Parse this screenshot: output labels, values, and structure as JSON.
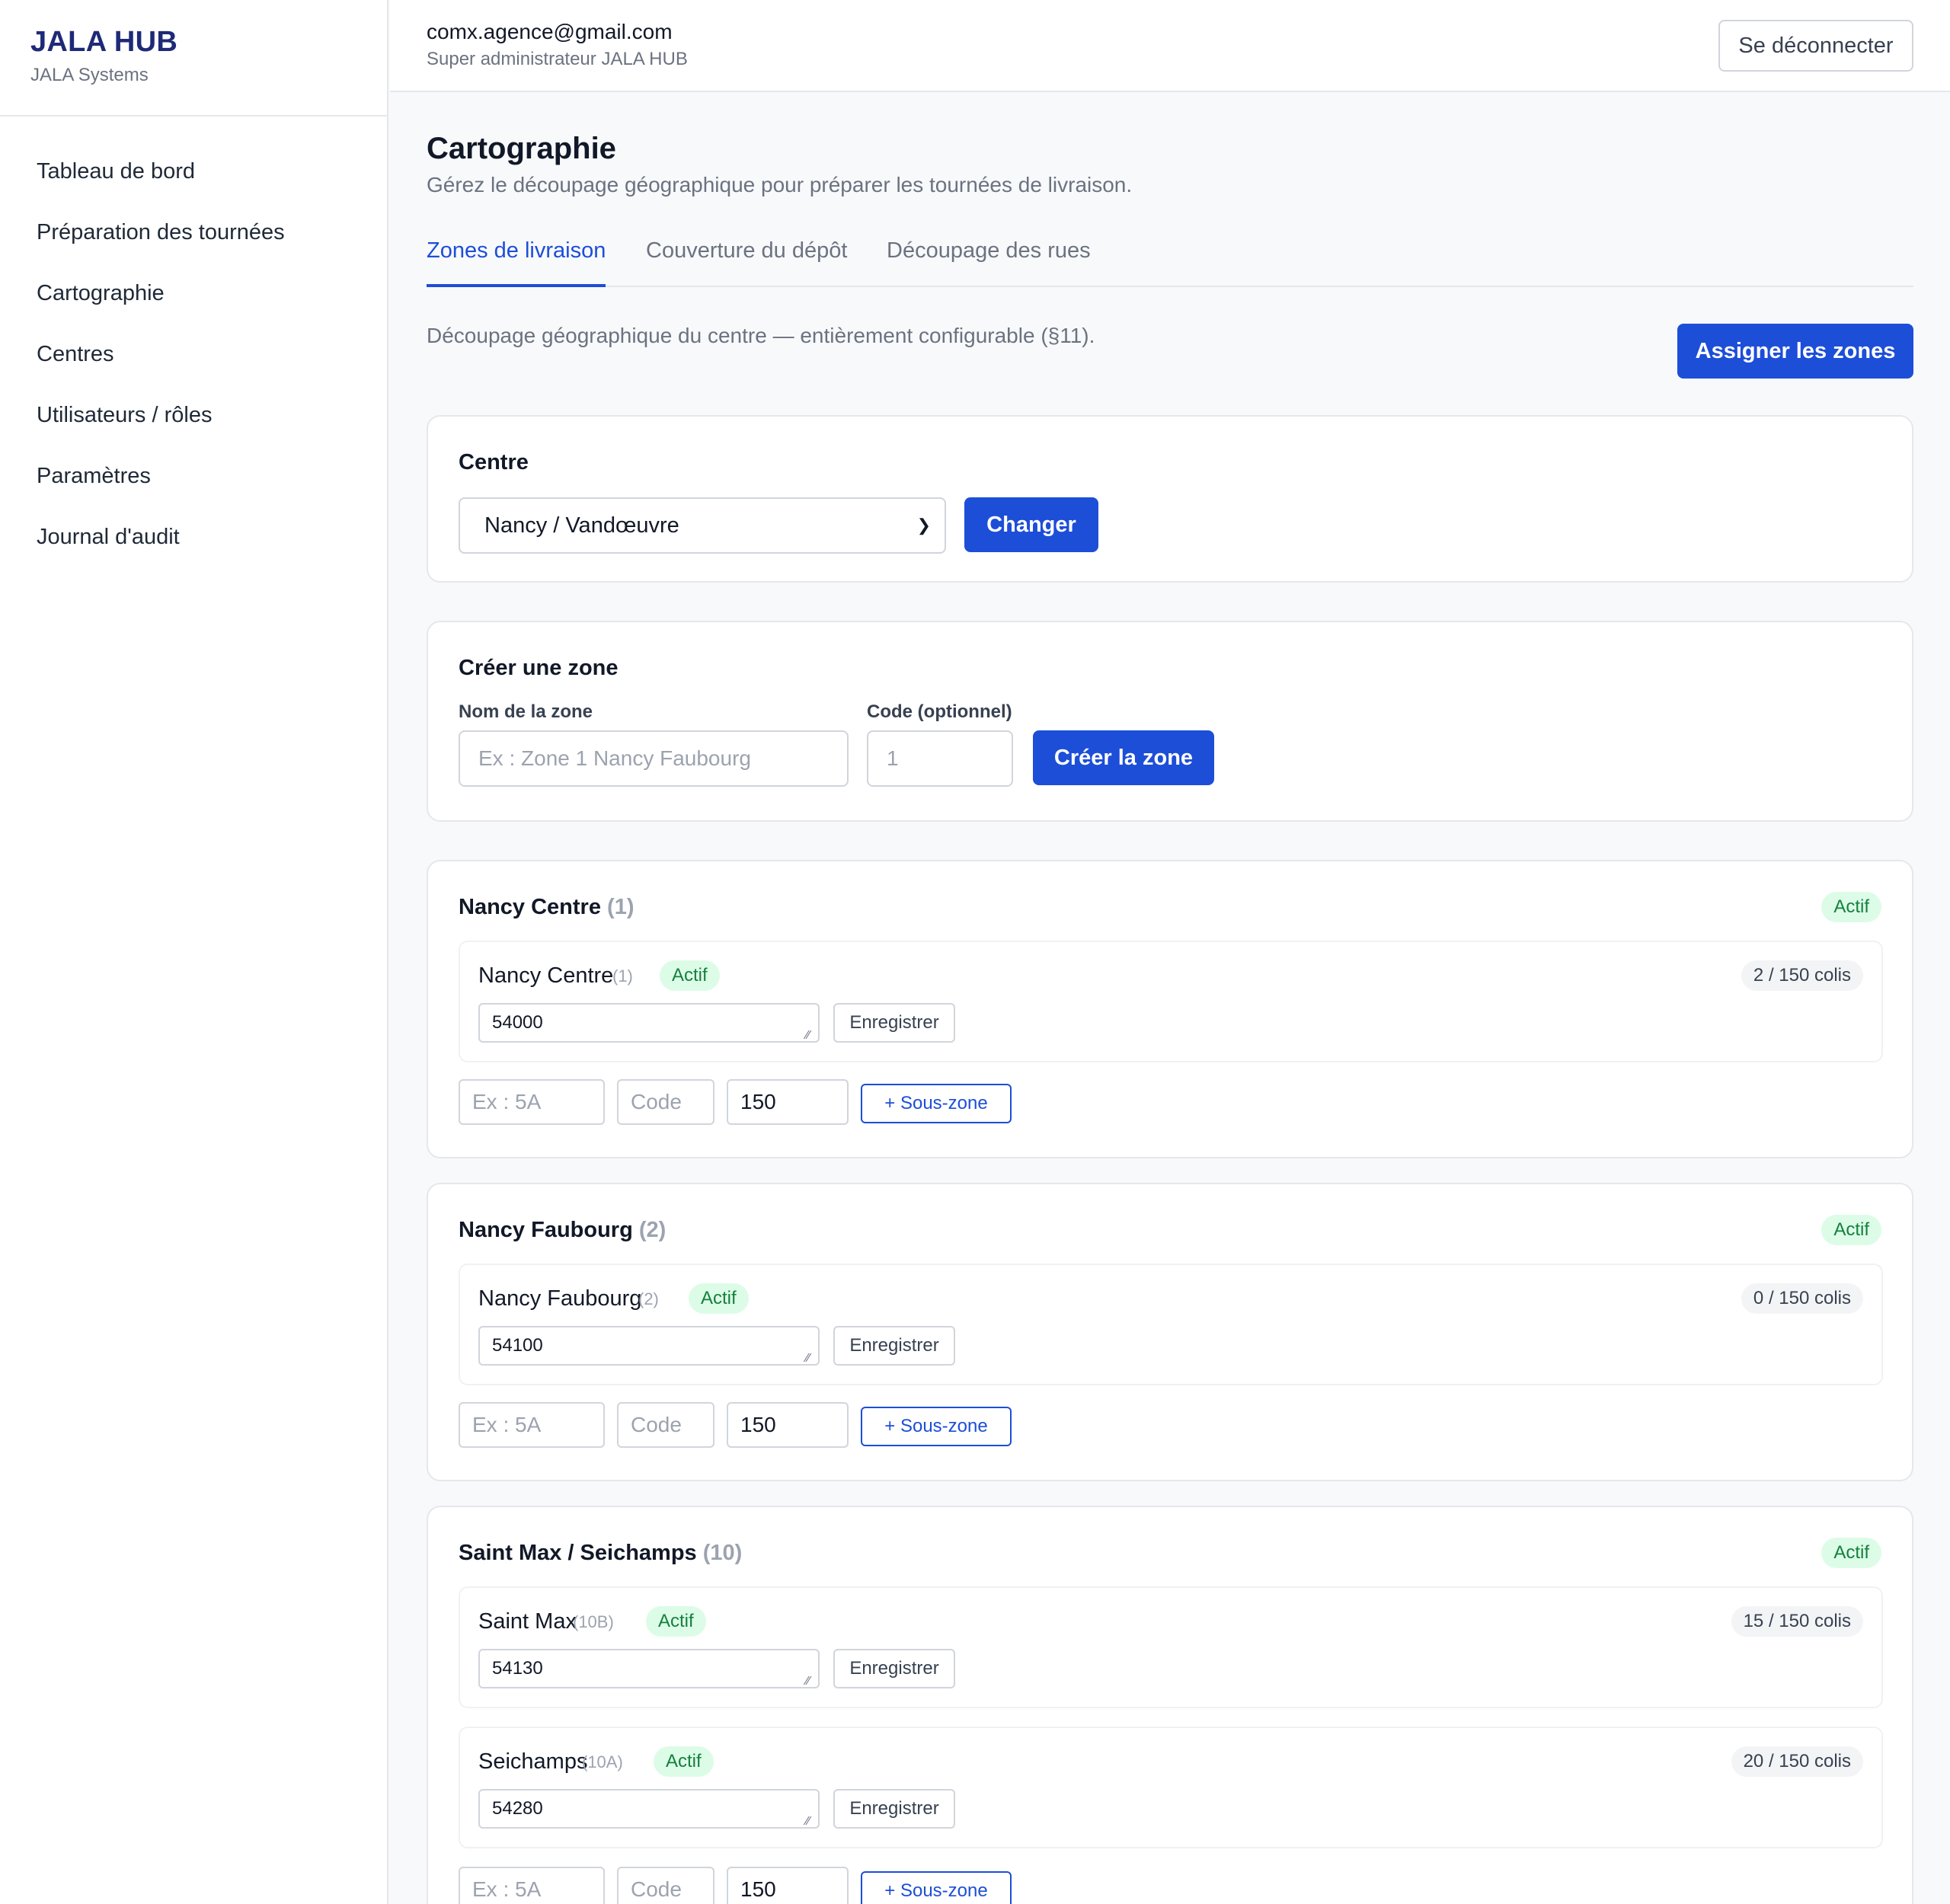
{
  "brand": {
    "title": "JALA HUB",
    "subtitle": "JALA Systems"
  },
  "nav": [
    "Tableau de bord",
    "Préparation des tournées",
    "Cartographie",
    "Centres",
    "Utilisateurs / rôles",
    "Paramètres",
    "Journal d'audit"
  ],
  "topbar": {
    "email": "comx.agence@gmail.com",
    "role": "Super administrateur JALA HUB",
    "logout": "Se déconnecter"
  },
  "page": {
    "title": "Cartographie",
    "subtitle": "Gérez le découpage géographique pour préparer les tournées de livraison."
  },
  "tabs": [
    "Zones de livraison",
    "Couverture du dépôt",
    "Découpage des rues"
  ],
  "active_tab": "Zones de livraison",
  "description": "Découpage géographique du centre — entièrement configurable (§11).",
  "assign_button": "Assigner les zones",
  "centre_card": {
    "title": "Centre",
    "selected": "Nancy / Vandœuvre",
    "change_button": "Changer"
  },
  "create_card": {
    "title": "Créer une zone",
    "name_label": "Nom de la zone",
    "name_placeholder": "Ex : Zone 1 Nancy Faubourg",
    "code_label": "Code (optionnel)",
    "code_placeholder": "1",
    "create_button": "Créer la zone"
  },
  "common": {
    "status": "Actif",
    "save": "Enregistrer",
    "subzone_name_placeholder": "Ex : 5A",
    "subzone_code_placeholder": "Code",
    "subzone_capacity": "150",
    "add_subzone": "+ Sous-zone"
  },
  "zones": [
    {
      "name": "Nancy Centre",
      "code": "(1)",
      "status": "Actif",
      "subzones": [
        {
          "name": "Nancy Centre",
          "code": "(1)",
          "status": "Actif",
          "postcodes": "54000",
          "count": "2 / 150 colis"
        }
      ]
    },
    {
      "name": "Nancy Faubourg",
      "code": "(2)",
      "status": "Actif",
      "subzones": [
        {
          "name": "Nancy Faubourg",
          "code": "(2)",
          "status": "Actif",
          "postcodes": "54100",
          "count": "0 / 150 colis"
        }
      ]
    },
    {
      "name": "Saint Max / Seichamps",
      "code": "(10)",
      "status": "Actif",
      "subzones": [
        {
          "name": "Saint Max",
          "code": "(10B)",
          "status": "Actif",
          "postcodes": "54130",
          "count": "15 / 150 colis"
        },
        {
          "name": "Seichamps",
          "code": "(10A)",
          "status": "Actif",
          "postcodes": "54280",
          "count": "20 / 150 colis"
        }
      ]
    }
  ],
  "colors": {
    "accent": "#1d4ed8",
    "brand": "#1e2a78",
    "success_bg": "#dcfce7",
    "success_text": "#15803d"
  }
}
